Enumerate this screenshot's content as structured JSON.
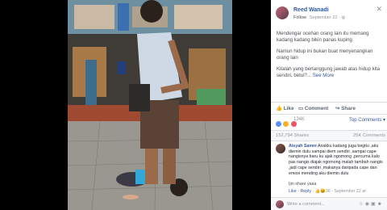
{
  "post": {
    "author": "Reed Wanadi",
    "follow_label": "Follow",
    "meta_time": "September 22 ·",
    "close_glyph": "✕",
    "paragraphs": [
      "Mendengar ocehan orang lain itu memang kadang kadang bikin panas kuping",
      "Namun hidup ini bukan buat menyenangkan orang lain",
      "Kitalah yang bertanggung jawab atas hidup kita sendiri, betul?..."
    ],
    "see_more": "See More"
  },
  "actions": {
    "like": "Like",
    "comment": "Comment",
    "share": "Share"
  },
  "reactions": {
    "count": "134K",
    "top_comments": "Top Comments ▾"
  },
  "stats": {
    "shares": "152,794 Shares",
    "comments": "25K Comments"
  },
  "comment": {
    "name": "Aisyah Samni",
    "text": "Anakku kadang juga begitu ,aku diemin dulu sampai diem sendiri ,sampai cape nangisnya baru ku ajak ngomong ,percuma kalo pas nangis diajak ngomong malah tambah nangis ,jadi cape sendiri ,makanya daripada cape dan emosi mending aku diemin dulu",
    "reply": "Ijin share yaaa",
    "like": "Like",
    "reply_link": "Reply",
    "reaction_count": "36",
    "time": "September 22 at"
  },
  "composer": {
    "placeholder": "Write a comment..."
  },
  "colors": {
    "link": "#365899",
    "muted": "#90949c",
    "like_blue": "#5890ff",
    "haha_yellow": "#f7b125"
  }
}
